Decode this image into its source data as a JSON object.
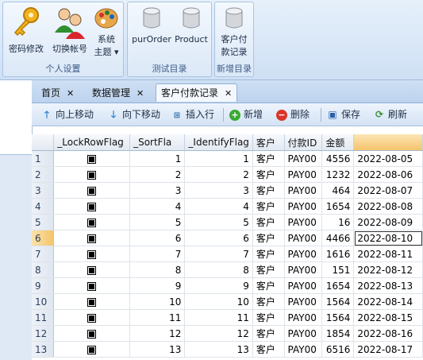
{
  "ribbon": {
    "group1": {
      "label": "个人设置",
      "buttons": [
        {
          "label": "密码修改",
          "icon": "key-icon"
        },
        {
          "label": "切换帐号",
          "icon": "users-icon"
        },
        {
          "label": "系统",
          "label2": "主题",
          "icon": "palette-icon"
        }
      ]
    },
    "group2": {
      "label": "测试目录",
      "buttons": [
        {
          "label": "purOrder",
          "icon": "database-icon"
        },
        {
          "label": "Product",
          "icon": "database-icon"
        }
      ]
    },
    "group3": {
      "label": "新增目录",
      "buttons": [
        {
          "label": "客户付",
          "label2": "款记录",
          "icon": "database-icon"
        }
      ]
    }
  },
  "tabs": [
    {
      "label": "首页",
      "close": "✕"
    },
    {
      "label": "数据管理",
      "close": "✕"
    },
    {
      "label": "客户付款记录",
      "close": "✕"
    }
  ],
  "toolbar": {
    "up": "向上移动",
    "down": "向下移动",
    "insert": "插入行",
    "add": "新增",
    "delete": "删除",
    "save": "保存",
    "refresh": "刷新"
  },
  "grid": {
    "columns": [
      "_LockRowFlag",
      "_SortFla",
      "_IdentifyFlag",
      "客户",
      "付款ID",
      "金额",
      ""
    ],
    "rows": [
      {
        "n": "1",
        "sort": "1",
        "id": "1",
        "cust": "客户",
        "pay": "PAY00",
        "amt": "4556",
        "date": "2022-08-05"
      },
      {
        "n": "2",
        "sort": "2",
        "id": "2",
        "cust": "客户",
        "pay": "PAY00",
        "amt": "1232",
        "date": "2022-08-06"
      },
      {
        "n": "3",
        "sort": "3",
        "id": "3",
        "cust": "客户",
        "pay": "PAY00",
        "amt": "464",
        "date": "2022-08-07"
      },
      {
        "n": "4",
        "sort": "4",
        "id": "4",
        "cust": "客户",
        "pay": "PAY00",
        "amt": "1654",
        "date": "2022-08-08"
      },
      {
        "n": "5",
        "sort": "5",
        "id": "5",
        "cust": "客户",
        "pay": "PAY00",
        "amt": "16",
        "date": "2022-08-09"
      },
      {
        "n": "6",
        "sort": "6",
        "id": "6",
        "cust": "客户",
        "pay": "PAY00",
        "amt": "4466",
        "date": "2022-08-10"
      },
      {
        "n": "7",
        "sort": "7",
        "id": "7",
        "cust": "客户",
        "pay": "PAY00",
        "amt": "1616",
        "date": "2022-08-11"
      },
      {
        "n": "8",
        "sort": "8",
        "id": "8",
        "cust": "客户",
        "pay": "PAY00",
        "amt": "151",
        "date": "2022-08-12"
      },
      {
        "n": "9",
        "sort": "9",
        "id": "9",
        "cust": "客户",
        "pay": "PAY00",
        "amt": "1654",
        "date": "2022-08-13"
      },
      {
        "n": "10",
        "sort": "10",
        "id": "10",
        "cust": "客户",
        "pay": "PAY00",
        "amt": "1564",
        "date": "2022-08-14"
      },
      {
        "n": "11",
        "sort": "11",
        "id": "11",
        "cust": "客户",
        "pay": "PAY00",
        "amt": "1564",
        "date": "2022-08-15"
      },
      {
        "n": "12",
        "sort": "12",
        "id": "12",
        "cust": "客户",
        "pay": "PAY00",
        "amt": "1854",
        "date": "2022-08-16"
      },
      {
        "n": "13",
        "sort": "13",
        "id": "13",
        "cust": "客户",
        "pay": "PAY00",
        "amt": "6516",
        "date": "2022-08-17"
      }
    ]
  }
}
